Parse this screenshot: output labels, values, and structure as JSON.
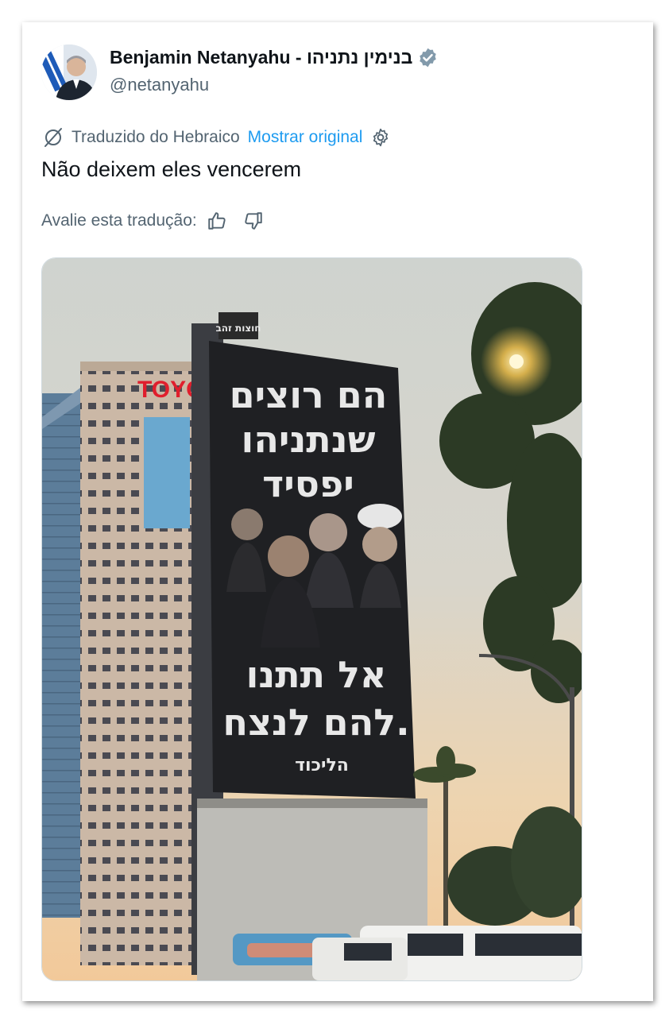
{
  "tweet": {
    "author": {
      "display_name": "Benjamin Netanyahu - בנימין נתניהו",
      "handle": "@netanyahu",
      "verified": true,
      "avatar_icon": "avatar-photo"
    },
    "translation": {
      "label": "Traduzido do Hebraico",
      "show_original": "Mostrar original",
      "icon": "translate-icon",
      "settings_icon": "gear-icon"
    },
    "text": "Não deixem eles vencerem",
    "rating": {
      "label": "Avalie esta tradução:",
      "thumbs_up_icon": "thumbs-up-icon",
      "thumbs_down_icon": "thumbs-down-icon"
    },
    "media": {
      "sign_top": "חוצות זהב",
      "building_sign": "TOYO",
      "banner_lines_top": [
        "הם רוצים",
        "שנתניהו",
        "יפסיד"
      ],
      "banner_lines_bottom": [
        "אל תתנו",
        "להם לנצח."
      ],
      "banner_logo": "הליכוד"
    }
  },
  "colors": {
    "accent": "#1d9bf0",
    "text": "#0f1419",
    "muted": "#536471",
    "verified": "#829aab"
  }
}
